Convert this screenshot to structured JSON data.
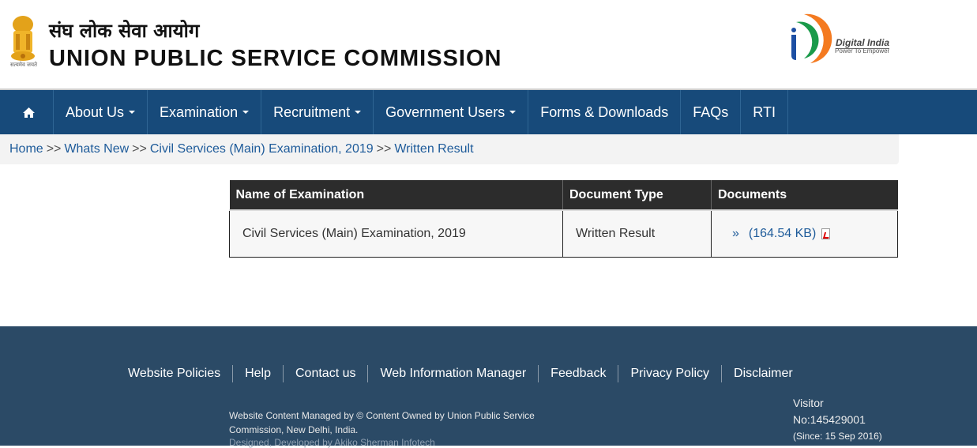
{
  "header": {
    "emblem_motto": "सत्यमेव जयते",
    "title_hindi": "संघ लोक सेवा आयोग",
    "title_english": "UNION PUBLIC SERVICE COMMISSION",
    "digital_india_title": "Digital India",
    "digital_india_tagline": "Power To Empower"
  },
  "nav": {
    "home_icon": "home-icon",
    "items": [
      {
        "label": "About Us",
        "dropdown": true
      },
      {
        "label": "Examination",
        "dropdown": true
      },
      {
        "label": "Recruitment",
        "dropdown": true
      },
      {
        "label": "Government Users",
        "dropdown": true
      },
      {
        "label": "Forms & Downloads",
        "dropdown": false
      },
      {
        "label": "FAQs",
        "dropdown": false
      },
      {
        "label": "RTI",
        "dropdown": false
      }
    ]
  },
  "breadcrumb": {
    "separator": ">>",
    "items": [
      "Home",
      "Whats New",
      "Civil Services (Main) Examination, 2019",
      "Written Result"
    ]
  },
  "table": {
    "headers": [
      "Name of Examination",
      "Document Type",
      "Documents"
    ],
    "rows": [
      {
        "exam": "Civil Services (Main) Examination, 2019",
        "type": "Written Result",
        "bullet": "»",
        "doc_size": "(164.54 KB)",
        "doc_icon": "pdf-icon"
      }
    ]
  },
  "footer": {
    "links": [
      "Website Policies",
      "Help",
      "Contact us",
      "Web Information Manager",
      "Feedback",
      "Privacy Policy",
      "Disclaimer"
    ],
    "managed_text": "Website Content Managed by © Content Owned by Union Public Service Commission, New Delhi, India.",
    "designed_text": "Designed, Developed by Akiko Sherman Infotech",
    "visitor_label": "Visitor",
    "visitor_count": "No:145429001",
    "visitor_since": "(Since: 15 Sep 2016)"
  },
  "colors": {
    "nav_bg": "#174a7a",
    "footer_bg": "#2b4a66",
    "link": "#1e5b9a",
    "table_header_bg": "#2c2c2c"
  }
}
